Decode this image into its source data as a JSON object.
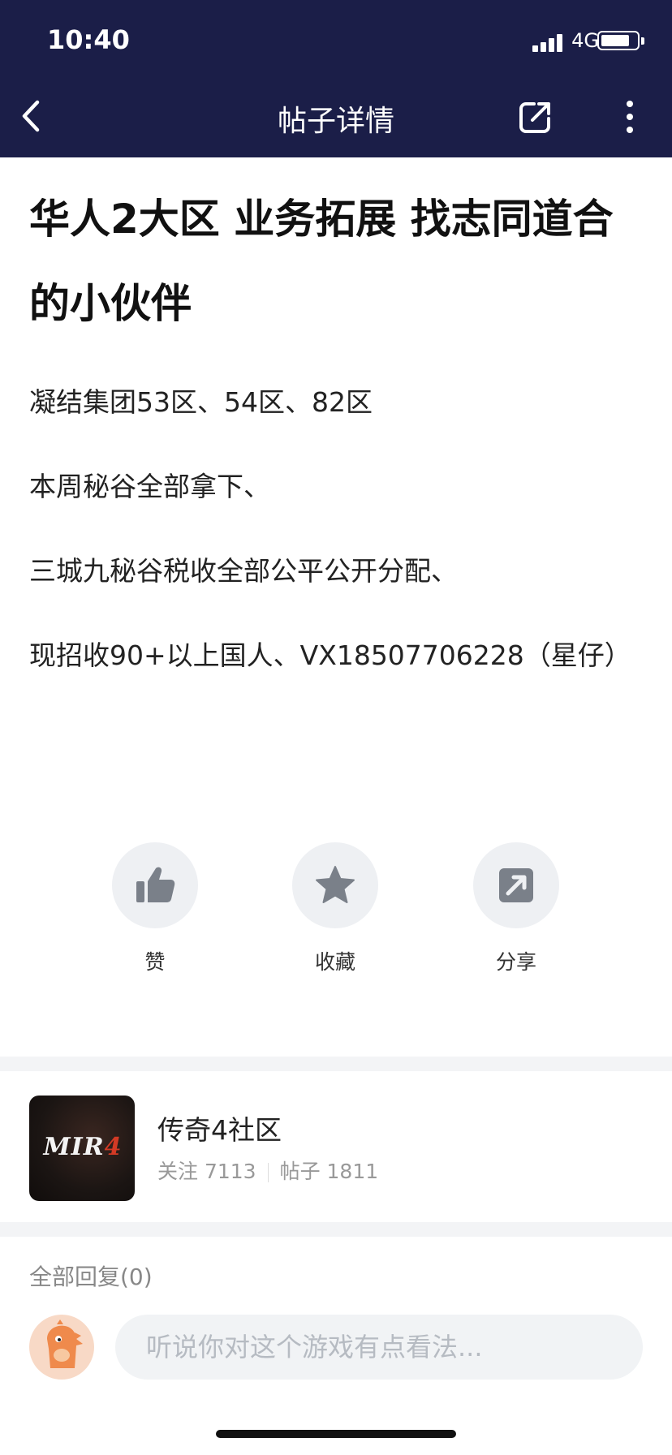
{
  "status_bar": {
    "time": "10:40",
    "network": "4G",
    "battery_level": 0.8
  },
  "nav": {
    "title": "帖子详情",
    "back_icon": "chevron-left-icon",
    "share_icon": "external-share-icon",
    "more_icon": "more-vertical-icon"
  },
  "post": {
    "title": "华人2大区 业务拓展 找志同道合的小伙伴",
    "paragraphs": [
      "凝结集团53区、54区、82区",
      "本周秘谷全部拿下、",
      "三城九秘谷税收全部公平公开分配、",
      "现招收90+以上国人、VX18507706228（星仔）"
    ]
  },
  "actions": [
    {
      "label": "赞",
      "icon": "thumbs-up-icon"
    },
    {
      "label": "收藏",
      "icon": "star-icon"
    },
    {
      "label": "分享",
      "icon": "share-arrow-icon"
    }
  ],
  "community": {
    "logo_text_main": "MIR",
    "logo_text_accent": "4",
    "name": "传奇4社区",
    "followers_label": "关注 7113",
    "posts_label": "帖子 1811"
  },
  "replies": {
    "header": "全部回复(0)",
    "input_placeholder": "听说你对这个游戏有点看法..."
  },
  "colors": {
    "header_bg": "#1b1e48",
    "icon_gray": "#7a8089",
    "circle_bg": "#eef0f3"
  }
}
